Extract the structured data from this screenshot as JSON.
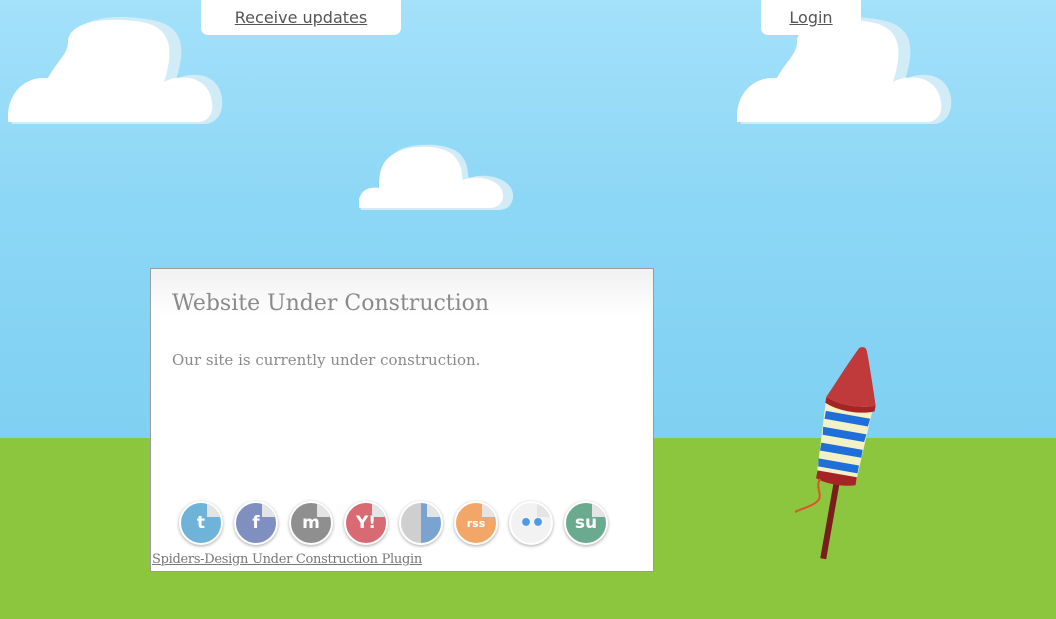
{
  "header": {
    "updates_label": "Receive updates",
    "login_label": "Login"
  },
  "panel": {
    "title": "Website Under Construction",
    "message": "Our site is currently under construction.",
    "plugin_link": "Spiders-Design Under Construction Plugin"
  },
  "social": [
    {
      "name": "twitter-icon",
      "glyph": "t",
      "color": "#6fb3d9"
    },
    {
      "name": "facebook-icon",
      "glyph": "f",
      "color": "#7f8fbf"
    },
    {
      "name": "myspace-icon",
      "glyph": "m",
      "color": "#8f8f8f"
    },
    {
      "name": "yahoo-icon",
      "glyph": "Y!",
      "color": "#d86a73"
    },
    {
      "name": "delicious-icon",
      "glyph": "",
      "color": "#cfcfcf"
    },
    {
      "name": "rss-icon",
      "glyph": "rss",
      "color": "#f2a768"
    },
    {
      "name": "flickr-icon",
      "glyph": "••",
      "color": "#f2f2f2"
    },
    {
      "name": "stumbleupon-icon",
      "glyph": "su",
      "color": "#6aaa8e"
    }
  ],
  "colors": {
    "sky": "#8dd7f6",
    "ground": "#8cc63f",
    "panel_text": "#8a8a8a",
    "rocket_red": "#c0393b",
    "rocket_blue": "#1e6fd9",
    "rocket_cream": "#f3f1c6"
  }
}
